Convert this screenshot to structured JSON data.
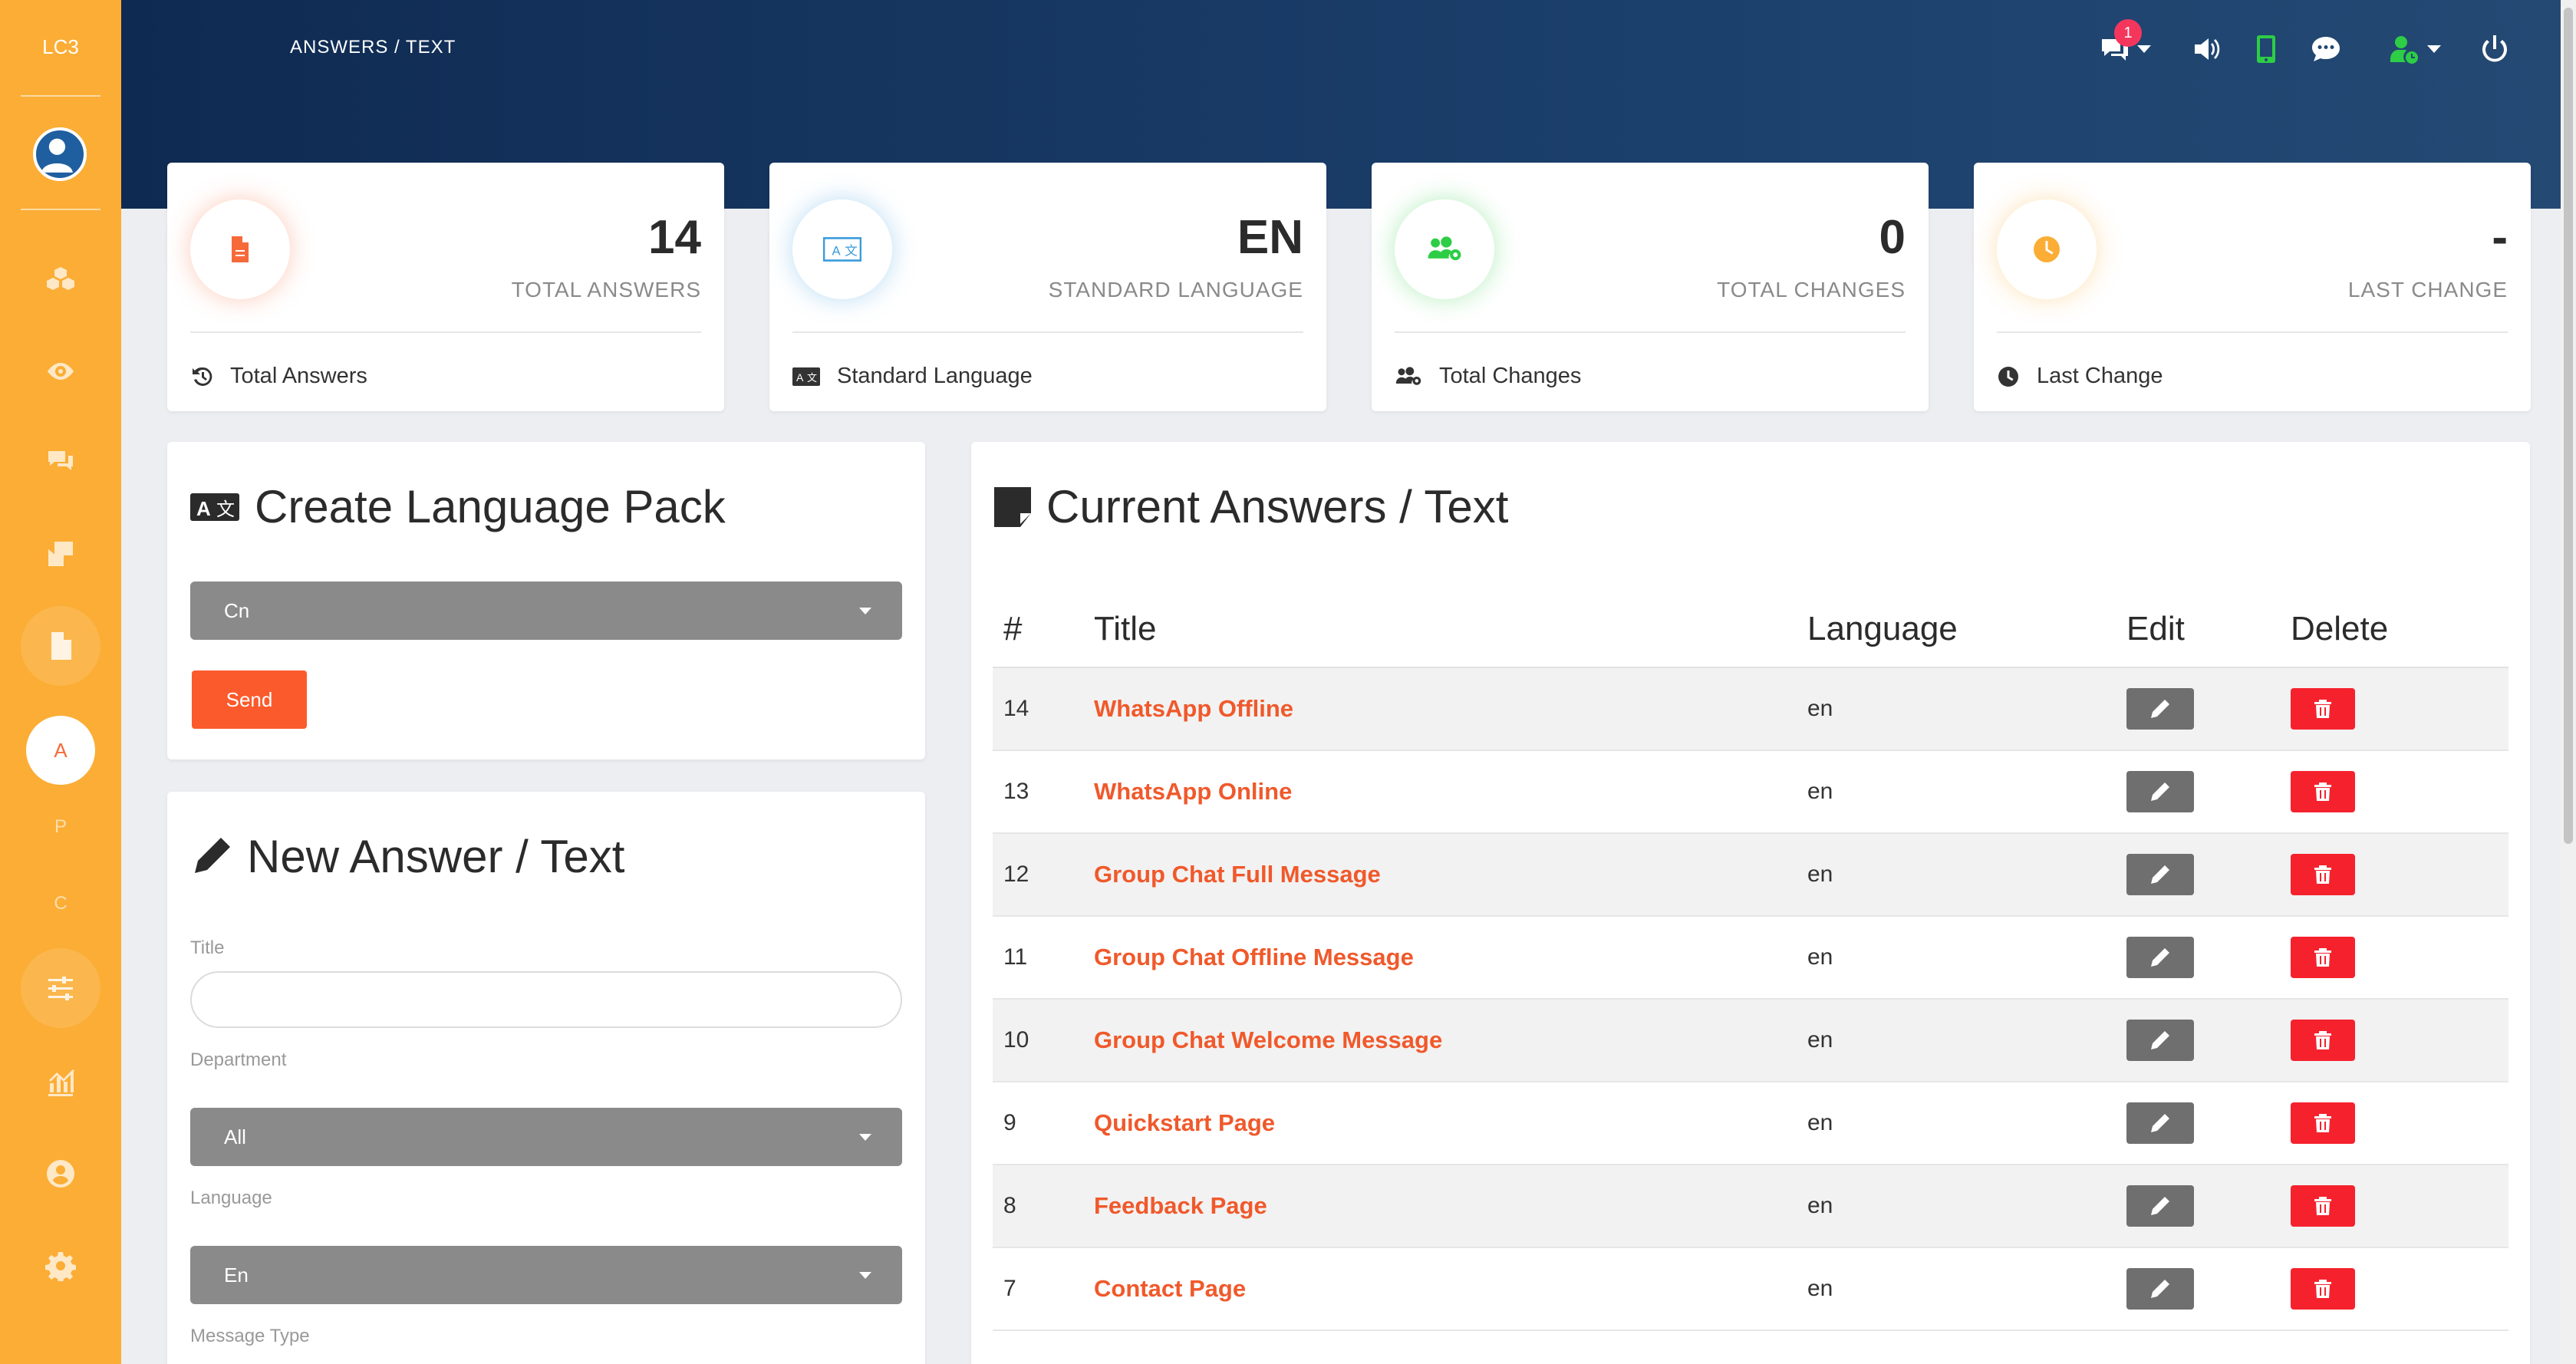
{
  "brand": "LC3",
  "breadcrumb": "ANSWERS / TEXT",
  "header": {
    "notification_count": "1"
  },
  "sidebar": {
    "letters": [
      "A",
      "P",
      "C"
    ]
  },
  "stats": [
    {
      "value": "14",
      "label": "TOTAL ANSWERS",
      "footer": "Total Answers",
      "icon": "file-icon",
      "color": "#f66a3a"
    },
    {
      "value": "EN",
      "label": "STANDARD LANGUAGE",
      "footer": "Standard Language",
      "icon": "language-icon",
      "color": "#3a9bdc"
    },
    {
      "value": "0",
      "label": "TOTAL CHANGES",
      "footer": "Total Changes",
      "icon": "users-cog-icon",
      "color": "#2dce45"
    },
    {
      "value": "-",
      "label": "LAST CHANGE",
      "footer": "Last Change",
      "icon": "clock-icon",
      "color": "#fbad35"
    }
  ],
  "create_pack": {
    "title": "Create Language Pack",
    "select_value": "Cn",
    "send_label": "Send"
  },
  "new_answer": {
    "title": "New Answer / Text",
    "title_label": "Title",
    "department_label": "Department",
    "department_value": "All",
    "language_label": "Language",
    "language_value": "En",
    "message_type_label": "Message Type"
  },
  "answers": {
    "title": "Current Answers / Text",
    "columns": [
      "#",
      "Title",
      "Language",
      "Edit",
      "Delete"
    ],
    "rows": [
      {
        "num": "14",
        "title": "WhatsApp Offline",
        "lang": "en"
      },
      {
        "num": "13",
        "title": "WhatsApp Online",
        "lang": "en"
      },
      {
        "num": "12",
        "title": "Group Chat Full Message",
        "lang": "en"
      },
      {
        "num": "11",
        "title": "Group Chat Offline Message",
        "lang": "en"
      },
      {
        "num": "10",
        "title": "Group Chat Welcome Message",
        "lang": "en"
      },
      {
        "num": "9",
        "title": "Quickstart Page",
        "lang": "en"
      },
      {
        "num": "8",
        "title": "Feedback Page",
        "lang": "en"
      },
      {
        "num": "7",
        "title": "Contact Page",
        "lang": "en"
      }
    ]
  },
  "colors": {
    "sidebar": "#fbad35",
    "accent": "#f0592b",
    "delete": "#f5222d",
    "header": "#14335e"
  }
}
